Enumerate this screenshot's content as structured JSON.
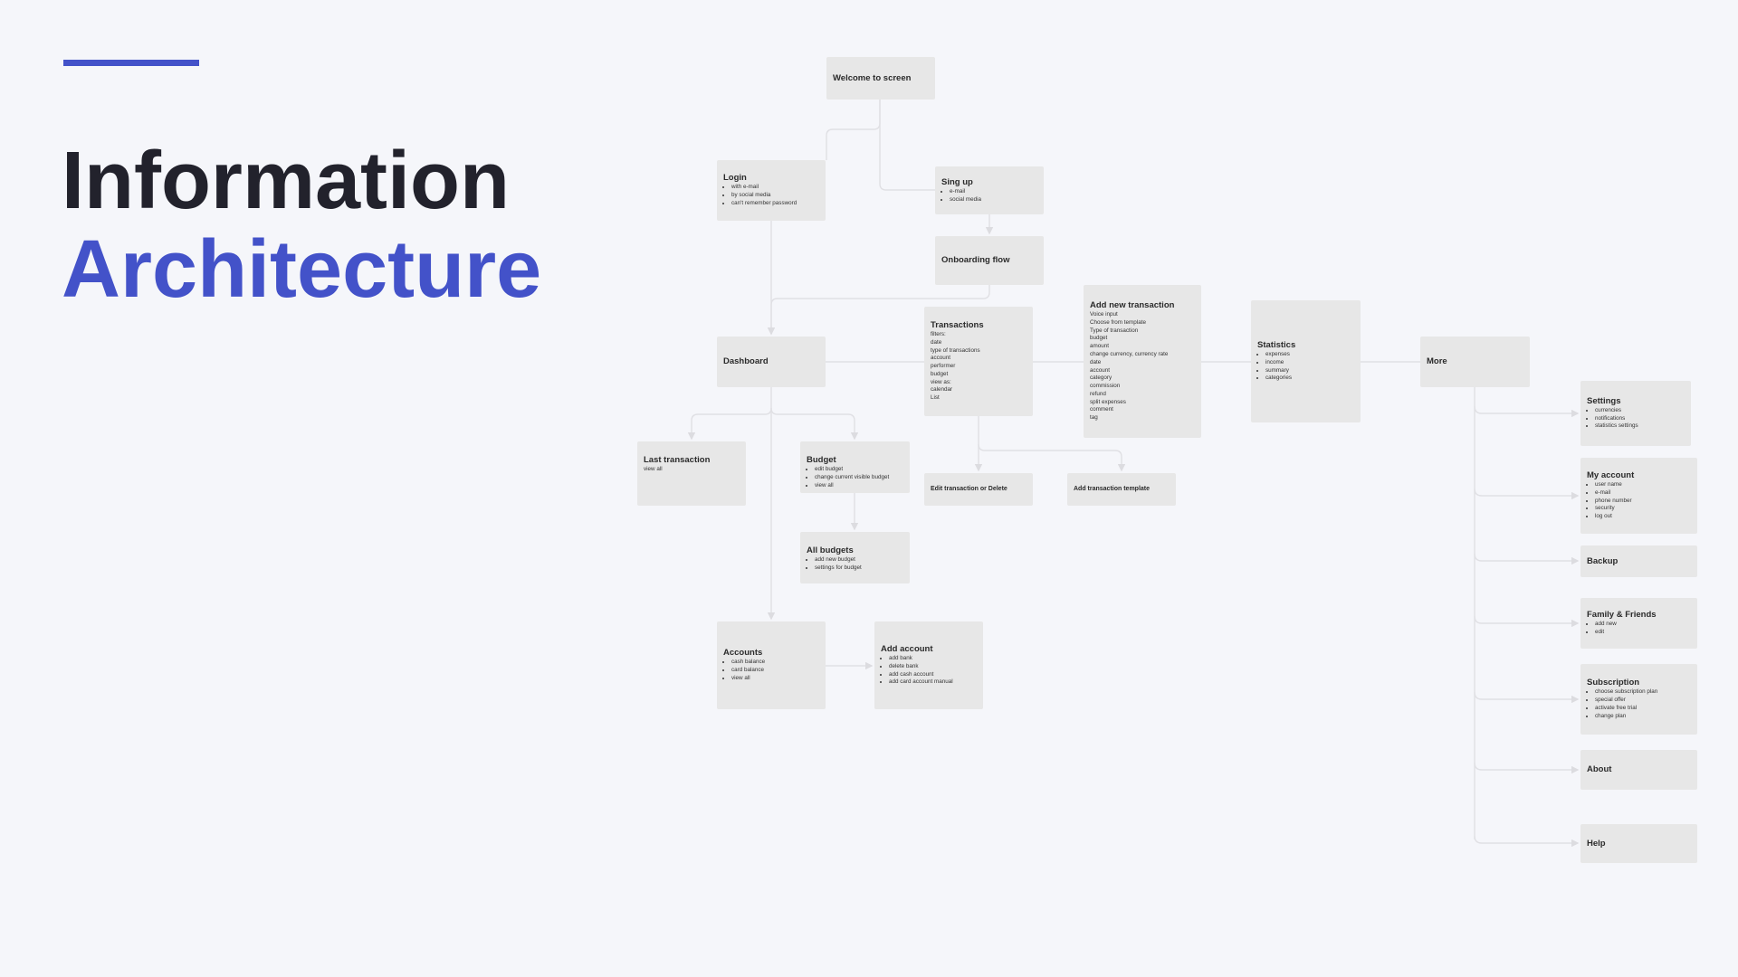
{
  "heading": {
    "line1": "Information",
    "line2": "Architecture"
  },
  "colors": {
    "accent": "#4352c9",
    "heading": "#22222c",
    "node_fill": "#e7e7e7",
    "background": "#f5f6fa",
    "connector": "#e0e0e4"
  },
  "nodes": {
    "welcome": {
      "title": "Welcome to screen",
      "items": []
    },
    "login": {
      "title": "Login",
      "bullets": true,
      "items": [
        "with e-mail",
        "by social media",
        "can't remember password"
      ]
    },
    "signup": {
      "title": "Sing up",
      "bullets": true,
      "items": [
        "e-mail",
        "social media"
      ]
    },
    "onboarding": {
      "title": "Onboarding flow",
      "items": []
    },
    "dashboard": {
      "title": "Dashboard",
      "items": []
    },
    "transactions": {
      "title": "Transactions",
      "bullets": false,
      "items": [
        "filters:",
        "date",
        "type of transactions",
        "account",
        "performer",
        "budget",
        "view as:",
        "calendar",
        "List"
      ]
    },
    "add_transaction": {
      "title": "Add new transaction",
      "bullets": false,
      "items": [
        "Voice input",
        "Choose from template",
        "Type of transaction",
        "budget",
        "amount",
        "change currency, currency rate",
        "date",
        "account",
        "category",
        "commission",
        "refund",
        "split expenses",
        "comment",
        "tag"
      ]
    },
    "statistics": {
      "title": "Statistics",
      "bullets": true,
      "items": [
        "expenses",
        "income",
        "summary",
        "categories"
      ]
    },
    "more": {
      "title": "More",
      "items": []
    },
    "last_transaction": {
      "title": "Last transaction",
      "bullets": false,
      "items": [
        "view all"
      ]
    },
    "budget": {
      "title": "Budget",
      "bullets": true,
      "items": [
        "edit budget",
        "change current visible budget",
        "view all"
      ]
    },
    "all_budgets": {
      "title": "All budgets",
      "bullets": true,
      "items": [
        "add new budget",
        "settings for budget"
      ]
    },
    "edit_transaction": {
      "title": "Edit transaction or Delete",
      "items": []
    },
    "add_template": {
      "title": "Add transaction template",
      "items": []
    },
    "accounts": {
      "title": "Accounts",
      "bullets": true,
      "items": [
        "cash balance",
        "card balance",
        "view all"
      ]
    },
    "add_account": {
      "title": "Add account",
      "bullets": true,
      "items": [
        "add bank",
        "delete bank",
        "add cash account",
        "add card account manual"
      ]
    },
    "settings": {
      "title": "Settings",
      "bullets": true,
      "items": [
        "currencies",
        "notifications",
        "statistics settings"
      ]
    },
    "my_account": {
      "title": "My account",
      "bullets": true,
      "items": [
        "user name",
        "e-mail",
        "phone number",
        "security",
        "log out"
      ]
    },
    "backup": {
      "title": "Backup",
      "items": []
    },
    "family": {
      "title": "Family & Friends",
      "bullets": true,
      "items": [
        "add new",
        "edit"
      ]
    },
    "subscription": {
      "title": "Subscription",
      "bullets": true,
      "items": [
        "choose subscription plan",
        "special offer",
        "activate free trial",
        "change plan"
      ]
    },
    "about": {
      "title": "About",
      "items": []
    },
    "help": {
      "title": "Help",
      "items": []
    }
  }
}
